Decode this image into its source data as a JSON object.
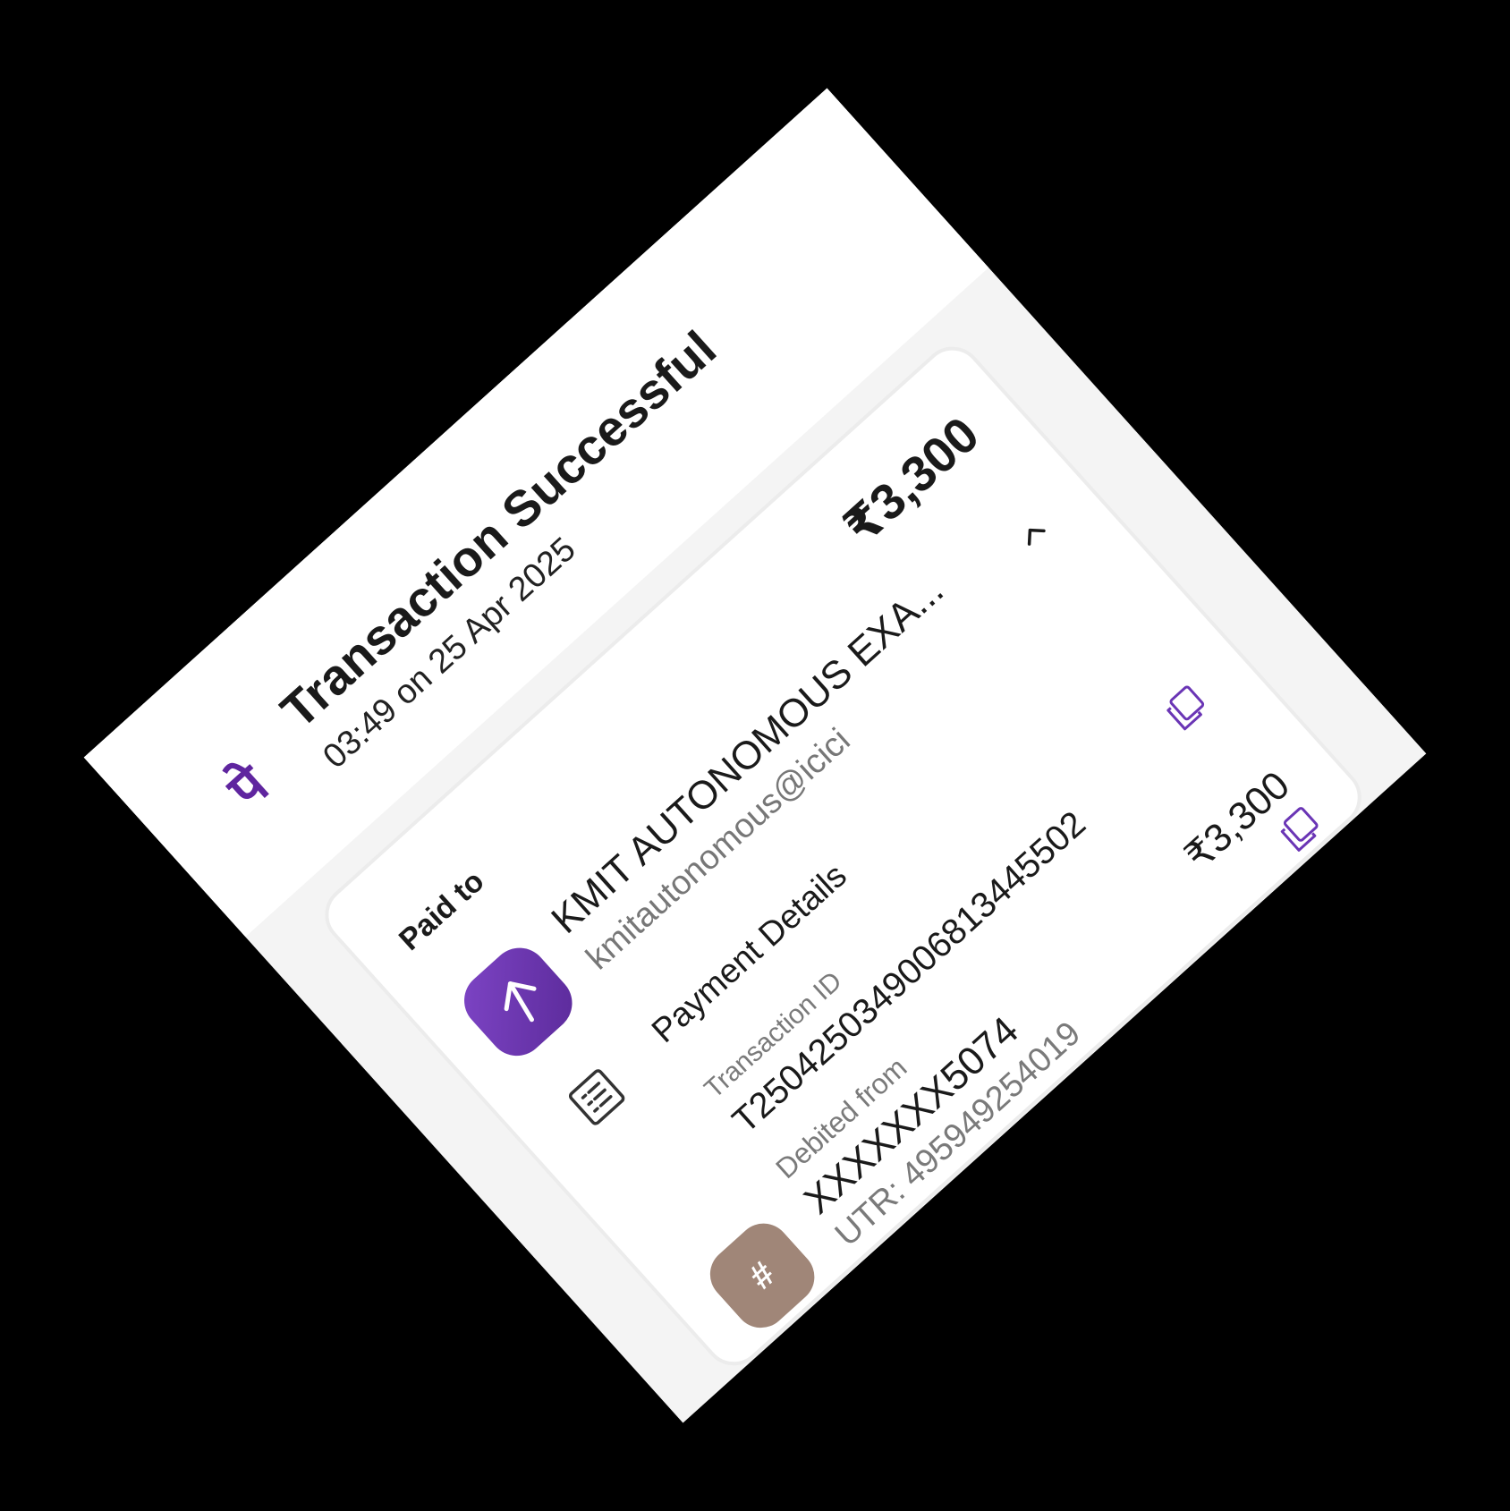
{
  "header": {
    "title": "Transaction Successful",
    "subtitle": "03:49 on 25 Apr 2025",
    "brand_icon": "phonepe-logo",
    "brand_glyph": "पे"
  },
  "paid_to": {
    "label": "Paid to",
    "amount": "₹3,300",
    "merchant_name": "KMIT AUTONOMOUS EXA...",
    "merchant_upi": "kmitautonomous@icici",
    "avatar_icon": "arrow-up-icon"
  },
  "payment_details": {
    "label": "Payment Details",
    "icon": "receipt-icon"
  },
  "transaction": {
    "label": "Transaction ID",
    "id": "T2504250349006813445502"
  },
  "debited_from": {
    "label": "Debited from",
    "account": "XXXXXXX5074",
    "amount": "₹3,300",
    "utr": "UTR: 495949254019",
    "bank_glyph": "#"
  },
  "colors": {
    "brand": "#5f259f",
    "bank_avatar": "#a08678",
    "background": "#000000"
  }
}
